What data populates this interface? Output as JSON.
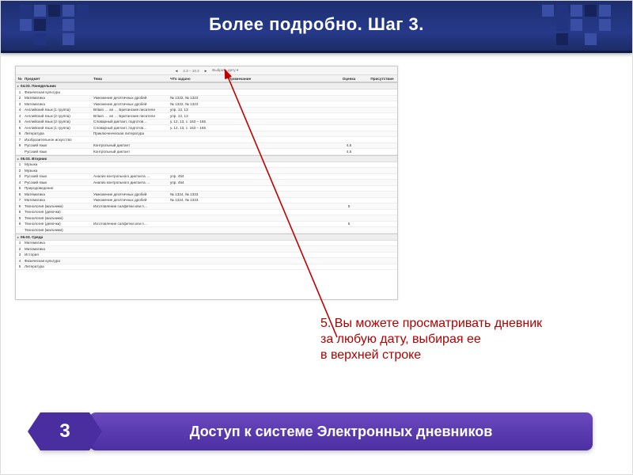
{
  "header": {
    "title": "Более подробно. Шаг 3."
  },
  "date_bar": {
    "prev": "◄",
    "range": "4.3 – 10.3",
    "next": "►",
    "choose": "Выбрать дату ▾"
  },
  "columns": {
    "n": "",
    "subject": "Предмет",
    "topic": "Тема",
    "homework": "ЧТо задано",
    "comment": "Примечание",
    "mark": "Оценка",
    "attendance": "Присутствие"
  },
  "lesson_number_label": "№",
  "days": [
    {
      "label": "04.03. Понедельник",
      "rows": [
        {
          "n": "1",
          "subj": "Физическая культура",
          "topic": "",
          "hw": "",
          "cmt": "",
          "mark": "",
          "att": ""
        },
        {
          "n": "2",
          "subj": "Математика",
          "topic": "Умножение десятичных дробей",
          "hw": "№ 1322, № 1323",
          "cmt": "",
          "mark": "",
          "att": ""
        },
        {
          "n": "3",
          "subj": "Математика",
          "topic": "Умножение десятичных дробей",
          "hw": "№ 1322, № 1323",
          "cmt": "",
          "mark": "",
          "att": ""
        },
        {
          "n": "4",
          "subj": "Английский язык (1 группа)",
          "topic": "Britain …  an …  Британские писатели",
          "hw": "упр. 12, 13",
          "cmt": "",
          "mark": "",
          "att": ""
        },
        {
          "n": "4",
          "subj": "Английский язык (2 группа)",
          "topic": "Britain …  an …  Британские писатели",
          "hw": "упр. 12, 13",
          "cmt": "",
          "mark": "",
          "att": ""
        },
        {
          "n": "5",
          "subj": "Английский язык (2 группа)",
          "topic": "Словарный диктант, подготов…",
          "hw": "у. 12, 13, с. 163 – 165",
          "cmt": "",
          "mark": "",
          "att": ""
        },
        {
          "n": "5",
          "subj": "Английский язык (1 группа)",
          "topic": "Словарный диктант, подготов…",
          "hw": "у. 12, 13, с. 163 – 165",
          "cmt": "",
          "mark": "",
          "att": ""
        },
        {
          "n": "6",
          "subj": "Литература",
          "topic": "Приключенческая литература",
          "hw": "",
          "cmt": "",
          "mark": "",
          "att": ""
        },
        {
          "n": "7",
          "subj": "Изобразительное искусство",
          "topic": "",
          "hw": "",
          "cmt": "",
          "mark": "",
          "att": ""
        },
        {
          "n": "9",
          "subj": "Русский язык",
          "topic": "Контрольный диктант",
          "hw": "",
          "cmt": "",
          "mark": "4,5",
          "att": ""
        },
        {
          "n": "",
          "subj": "Русский язык",
          "topic": "Контрольный диктант",
          "hw": "",
          "cmt": "",
          "mark": "4,5",
          "att": ""
        }
      ]
    },
    {
      "label": "05.03. Вторник",
      "rows": [
        {
          "n": "1",
          "subj": "Музыка",
          "topic": "",
          "hw": "",
          "cmt": "",
          "mark": "",
          "att": ""
        },
        {
          "n": "2",
          "subj": "Музыка",
          "topic": "",
          "hw": "",
          "cmt": "",
          "mark": "",
          "att": ""
        },
        {
          "n": "3",
          "subj": "Русский язык",
          "topic": "Анализ контрольного диктанта …",
          "hw": "упр. 454",
          "cmt": "",
          "mark": "",
          "att": ""
        },
        {
          "n": "4",
          "subj": "Русский язык",
          "topic": "Анализ контрольного диктанта …",
          "hw": "упр. 454",
          "cmt": "",
          "mark": "",
          "att": ""
        },
        {
          "n": "5",
          "subj": "Природоведение",
          "topic": "",
          "hw": "",
          "cmt": "",
          "mark": "",
          "att": ""
        },
        {
          "n": "6",
          "subj": "Математика",
          "topic": "Умножение десятичных дробей",
          "hw": "№ 1324, № 1333",
          "cmt": "",
          "mark": "",
          "att": ""
        },
        {
          "n": "7",
          "subj": "Математика",
          "topic": "Умножение десятичных дробей",
          "hw": "№ 1324, № 1333",
          "cmt": "",
          "mark": "",
          "att": ""
        },
        {
          "n": "8",
          "subj": "Технология (мальчики)",
          "topic": "Изготовление салфетки или п…",
          "hw": "",
          "cmt": "",
          "mark": "5",
          "att": ""
        },
        {
          "n": "8",
          "subj": "Технология (девочки)",
          "topic": "",
          "hw": "",
          "cmt": "",
          "mark": "",
          "att": ""
        },
        {
          "n": "9",
          "subj": "Технология (мальчики)",
          "topic": "",
          "hw": "",
          "cmt": "",
          "mark": "",
          "att": ""
        },
        {
          "n": "9",
          "subj": "Технология (девочки)",
          "topic": "Изготовление салфетки или п…",
          "hw": "",
          "cmt": "",
          "mark": "5",
          "att": ""
        },
        {
          "n": "",
          "subj": "Технология (мальчики)",
          "topic": "",
          "hw": "",
          "cmt": "",
          "mark": "",
          "att": ""
        }
      ]
    },
    {
      "label": "06.03. Среда",
      "rows": [
        {
          "n": "1",
          "subj": "Математика",
          "topic": "",
          "hw": "",
          "cmt": "",
          "mark": "",
          "att": ""
        },
        {
          "n": "2",
          "subj": "Математика",
          "topic": "",
          "hw": "",
          "cmt": "",
          "mark": "",
          "att": ""
        },
        {
          "n": "3",
          "subj": "История",
          "topic": "",
          "hw": "",
          "cmt": "",
          "mark": "",
          "att": ""
        },
        {
          "n": "4",
          "subj": "Физическая культура",
          "topic": "",
          "hw": "",
          "cmt": "",
          "mark": "",
          "att": ""
        },
        {
          "n": "5",
          "subj": "Литература",
          "topic": "",
          "hw": "",
          "cmt": "",
          "mark": "",
          "att": ""
        }
      ]
    }
  ],
  "callout": {
    "line1": "5. Вы можете просматривать дневник",
    "line2": "за любую дату, выбирая ее",
    "line3": " в верхней строке"
  },
  "footer": {
    "step": "3",
    "caption": "Доступ к системе Электронных дневников"
  }
}
